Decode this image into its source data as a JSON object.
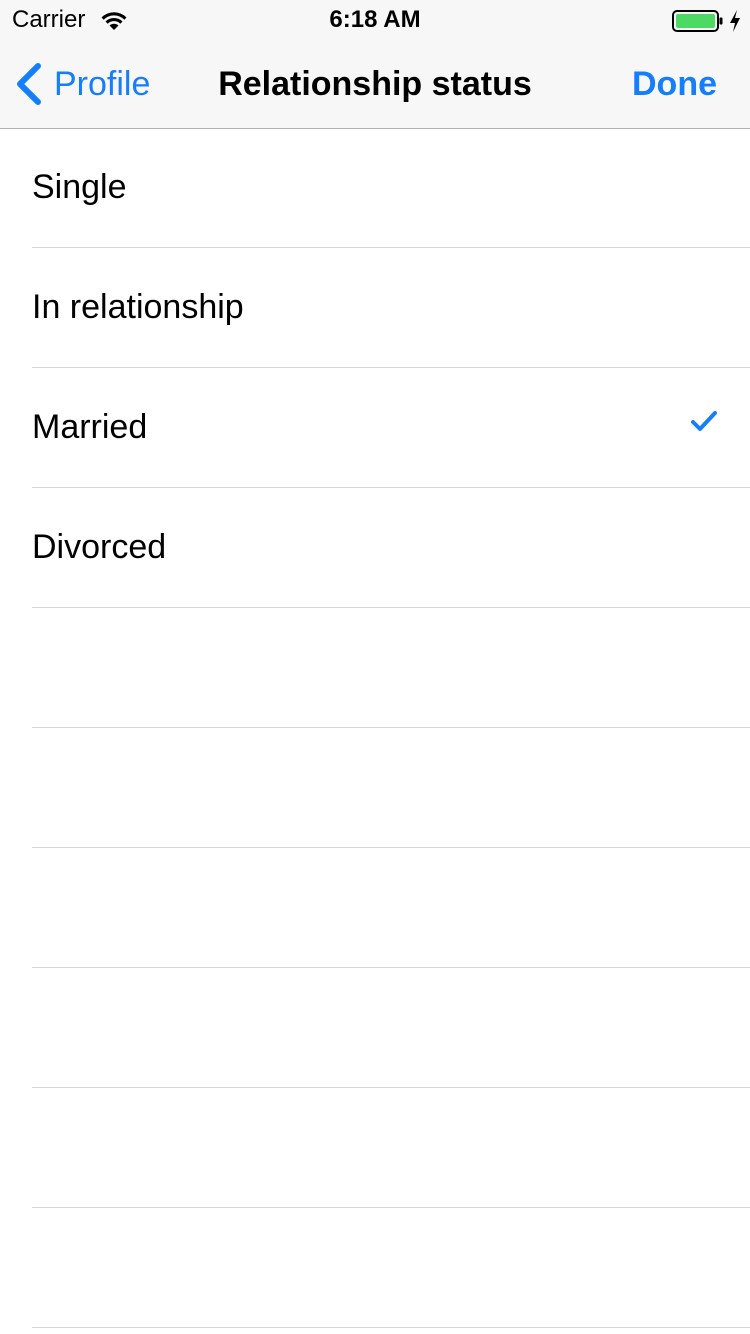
{
  "status_bar": {
    "carrier": "Carrier",
    "time": "6:18 AM",
    "battery_color": "#4cd964"
  },
  "nav": {
    "back_label": "Profile",
    "title": "Relationship status",
    "done_label": "Done",
    "accent_color": "#157efb"
  },
  "options": [
    {
      "label": "Single",
      "selected": false
    },
    {
      "label": "In relationship",
      "selected": false
    },
    {
      "label": "Married",
      "selected": true
    },
    {
      "label": "Divorced",
      "selected": false
    }
  ]
}
